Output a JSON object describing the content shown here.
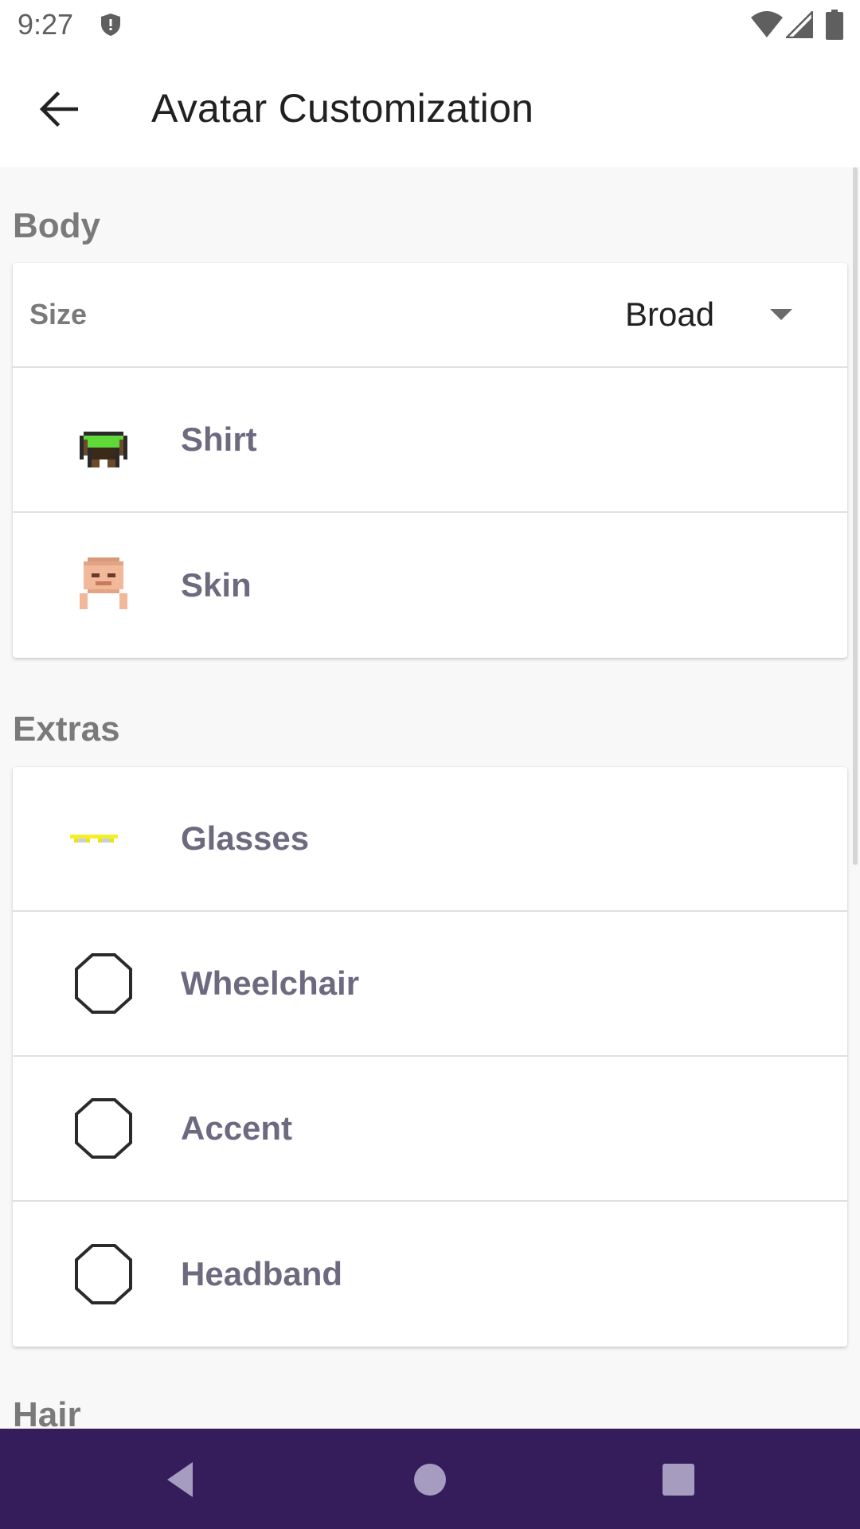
{
  "status_bar": {
    "time": "9:27"
  },
  "app_bar": {
    "title": "Avatar Customization"
  },
  "sections": {
    "body": {
      "header": "Body",
      "size": {
        "label": "Size",
        "value": "Broad"
      },
      "items": [
        {
          "label": "Shirt",
          "icon": "shirt-icon"
        },
        {
          "label": "Skin",
          "icon": "skin-icon"
        }
      ]
    },
    "extras": {
      "header": "Extras",
      "items": [
        {
          "label": "Glasses",
          "icon": "glasses-icon"
        },
        {
          "label": "Wheelchair",
          "icon": "wheelchair-icon"
        },
        {
          "label": "Accent",
          "icon": "accent-icon"
        },
        {
          "label": "Headband",
          "icon": "headband-icon"
        }
      ]
    },
    "hair": {
      "header": "Hair"
    }
  },
  "colors": {
    "nav_bar": "#351c5b",
    "label_text": "#6d6a80",
    "section_header": "#7a7a7a",
    "shirt_green": "#5fd83a",
    "glasses_yellow": "#f3f02b"
  }
}
